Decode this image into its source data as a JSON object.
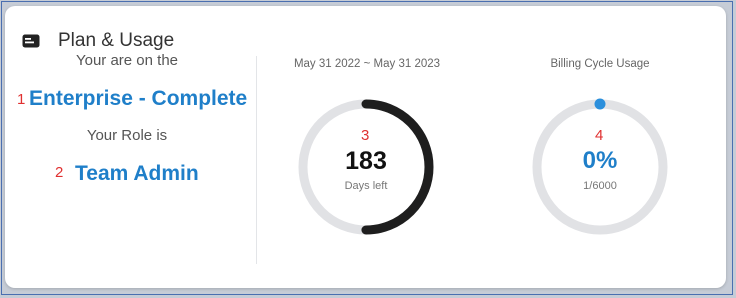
{
  "header": {
    "title": "Plan & Usage",
    "icon": "billing-card-icon"
  },
  "plan": {
    "intro": "Your are on the",
    "name": "Enterprise - Complete",
    "role_intro": "Your Role is",
    "role": "Team Admin"
  },
  "markers": [
    "1",
    "2",
    "3",
    "4"
  ],
  "days_ring": {
    "caption": "May 31 2022 ~ May 31 2023",
    "value": "183",
    "label": "Days left",
    "progress_fraction": 0.5
  },
  "usage_ring": {
    "caption": "Billing Cycle Usage",
    "value": "0%",
    "label": "1/6000",
    "progress_fraction": 0
  },
  "colors": {
    "accent": "#1f7fc9",
    "marker": "#e03030",
    "ring_track": "#e1e2e5",
    "ring_progress": "#1e1e1e",
    "usage_dot": "#2b8fdc"
  }
}
